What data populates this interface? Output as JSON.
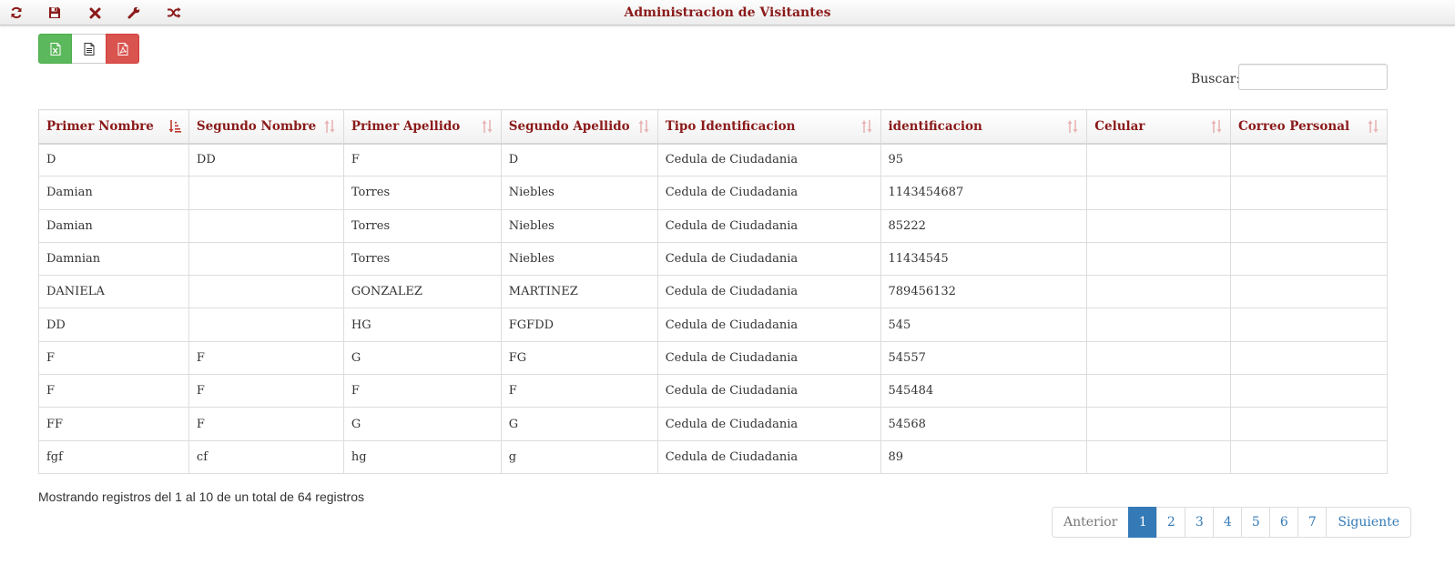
{
  "header": {
    "title": "Administracion de Visitantes",
    "toolbar": [
      {
        "icon": "refresh-icon"
      },
      {
        "icon": "save-icon"
      },
      {
        "icon": "close-icon"
      },
      {
        "icon": "wrench-icon"
      },
      {
        "icon": "shuffle-icon"
      }
    ]
  },
  "export": {
    "buttons": [
      {
        "icon": "excel-file-icon",
        "color": "#5cb85c"
      },
      {
        "icon": "text-file-icon",
        "color": "#ffffff"
      },
      {
        "icon": "pdf-file-icon",
        "color": "#d9534f"
      }
    ]
  },
  "search": {
    "label": "Buscar:",
    "value": "",
    "placeholder": ""
  },
  "table": {
    "columns": [
      "Primer Nombre",
      "Segundo Nombre",
      "Primer Apellido",
      "Segundo Apellido",
      "Tipo Identificacion",
      "identificacion",
      "Celular",
      "Correo Personal"
    ],
    "sorted_column": "Primer Nombre",
    "rows": [
      [
        "D",
        "DD",
        "F",
        "D",
        "Cedula de Ciudadania",
        "95",
        "",
        ""
      ],
      [
        "Damian",
        "",
        "Torres",
        "Niebles",
        "Cedula de Ciudadania",
        "1143454687",
        "",
        ""
      ],
      [
        "Damian",
        "",
        "Torres",
        "Niebles",
        "Cedula de Ciudadania",
        "85222",
        "",
        ""
      ],
      [
        "Damnian",
        "",
        "Torres",
        "Niebles",
        "Cedula de Ciudadania",
        "11434545",
        "",
        ""
      ],
      [
        "DANIELA",
        "",
        "GONZALEZ",
        "MARTINEZ",
        "Cedula de Ciudadania",
        "789456132",
        "",
        ""
      ],
      [
        "DD",
        "",
        "HG",
        "FGFDD",
        "Cedula de Ciudadania",
        "545",
        "",
        ""
      ],
      [
        "F",
        "F",
        "G",
        "FG",
        "Cedula de Ciudadania",
        "54557",
        "",
        ""
      ],
      [
        "F",
        "F",
        "F",
        "F",
        "Cedula de Ciudadania",
        "545484",
        "",
        ""
      ],
      [
        "FF",
        "F",
        "G",
        "G",
        "Cedula de Ciudadania",
        "54568",
        "",
        ""
      ],
      [
        "fgf",
        "cf",
        "hg",
        "g",
        "Cedula de Ciudadania",
        "89",
        "",
        ""
      ]
    ]
  },
  "footer": {
    "info": "Mostrando registros del 1 al 10 de un total de 64 registros",
    "pagination": {
      "previous": "Anterior",
      "pages": [
        "1",
        "2",
        "3",
        "4",
        "5",
        "6",
        "7"
      ],
      "active": "1",
      "next": "Siguiente"
    }
  },
  "colors": {
    "accent": "#8b1a1a",
    "primary": "#337ab7",
    "success": "#5cb85c",
    "danger": "#d9534f"
  }
}
